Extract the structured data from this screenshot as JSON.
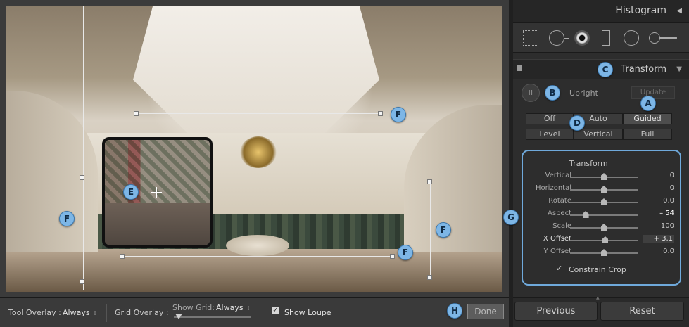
{
  "colors": {
    "accent": "#6fa9db",
    "badge": "#7db6e6"
  },
  "callouts": {
    "a": "A",
    "b": "B",
    "c": "C",
    "d": "D",
    "e": "E",
    "f": "F",
    "g": "G",
    "h": "H"
  },
  "toolbar": {
    "tool_overlay_label": "Tool Overlay :",
    "tool_overlay_value": "Always",
    "grid_overlay_label": "Grid Overlay :",
    "show_grid_label": "Show Grid:",
    "show_grid_value": "Always",
    "show_loupe_label": "Show Loupe",
    "show_loupe_checked": "✓",
    "done_label": "Done"
  },
  "panel": {
    "histogram_title": "Histogram",
    "transform_title": "Transform",
    "tool_icons": [
      "crop-overlay-icon",
      "spot-removal-icon",
      "red-eye-icon",
      "graduated-filter-icon",
      "radial-filter-icon",
      "adjustment-brush-icon"
    ],
    "upright": {
      "label": "Upright",
      "update_label": "Update",
      "modes_row1": [
        "Off",
        "Auto",
        "Guided"
      ],
      "modes_row2": [
        "Level",
        "Vertical",
        "Full"
      ],
      "selected": "Guided"
    },
    "sliders": {
      "title": "Transform",
      "items": [
        {
          "label": "Vertical",
          "value": "0",
          "level": 0.5
        },
        {
          "label": "Horizontal",
          "value": "0",
          "level": 0.5
        },
        {
          "label": "Rotate",
          "value": "0.0",
          "level": 0.5
        },
        {
          "label": "Aspect",
          "value": "– 54",
          "level": 0.23
        },
        {
          "label": "Scale",
          "value": "100",
          "level": 0.5
        },
        {
          "label": "X Offset",
          "value": "+ 3.1",
          "level": 0.52
        },
        {
          "label": "Y Offset",
          "value": "0.0",
          "level": 0.5
        }
      ],
      "constrain_crop_label": "Constrain Crop",
      "constrain_crop_checked": "✓"
    },
    "previous_label": "Previous",
    "reset_label": "Reset"
  }
}
